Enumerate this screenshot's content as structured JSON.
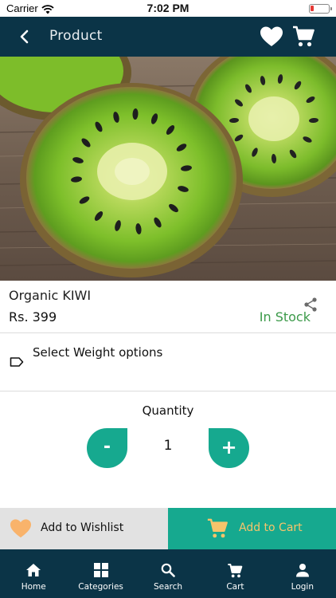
{
  "status_bar": {
    "carrier": "Carrier",
    "time": "7:02 PM"
  },
  "header": {
    "title": "Product"
  },
  "product": {
    "name": "Organic KIWI",
    "price": "Rs. 399",
    "stock": "In Stock",
    "weight_label": "Select Weight options"
  },
  "quantity": {
    "title": "Quantity",
    "value": "1",
    "minus_label": "-",
    "plus_label": "+"
  },
  "actions": {
    "wishlist_label": "Add to Wishlist",
    "cart_label": "Add to Cart"
  },
  "nav": [
    {
      "label": "Home",
      "icon": "home-icon"
    },
    {
      "label": "Categories",
      "icon": "grid-icon"
    },
    {
      "label": "Search",
      "icon": "search-icon"
    },
    {
      "label": "Cart",
      "icon": "cart-icon"
    },
    {
      "label": "Login",
      "icon": "person-icon"
    }
  ],
  "colors": {
    "brand_dark": "#0b3447",
    "accent_teal": "#16a98f",
    "stock_green": "#3c9a4a",
    "wishlist_orange": "#f9b36b",
    "cart_label_yellow": "#f7c46b"
  }
}
